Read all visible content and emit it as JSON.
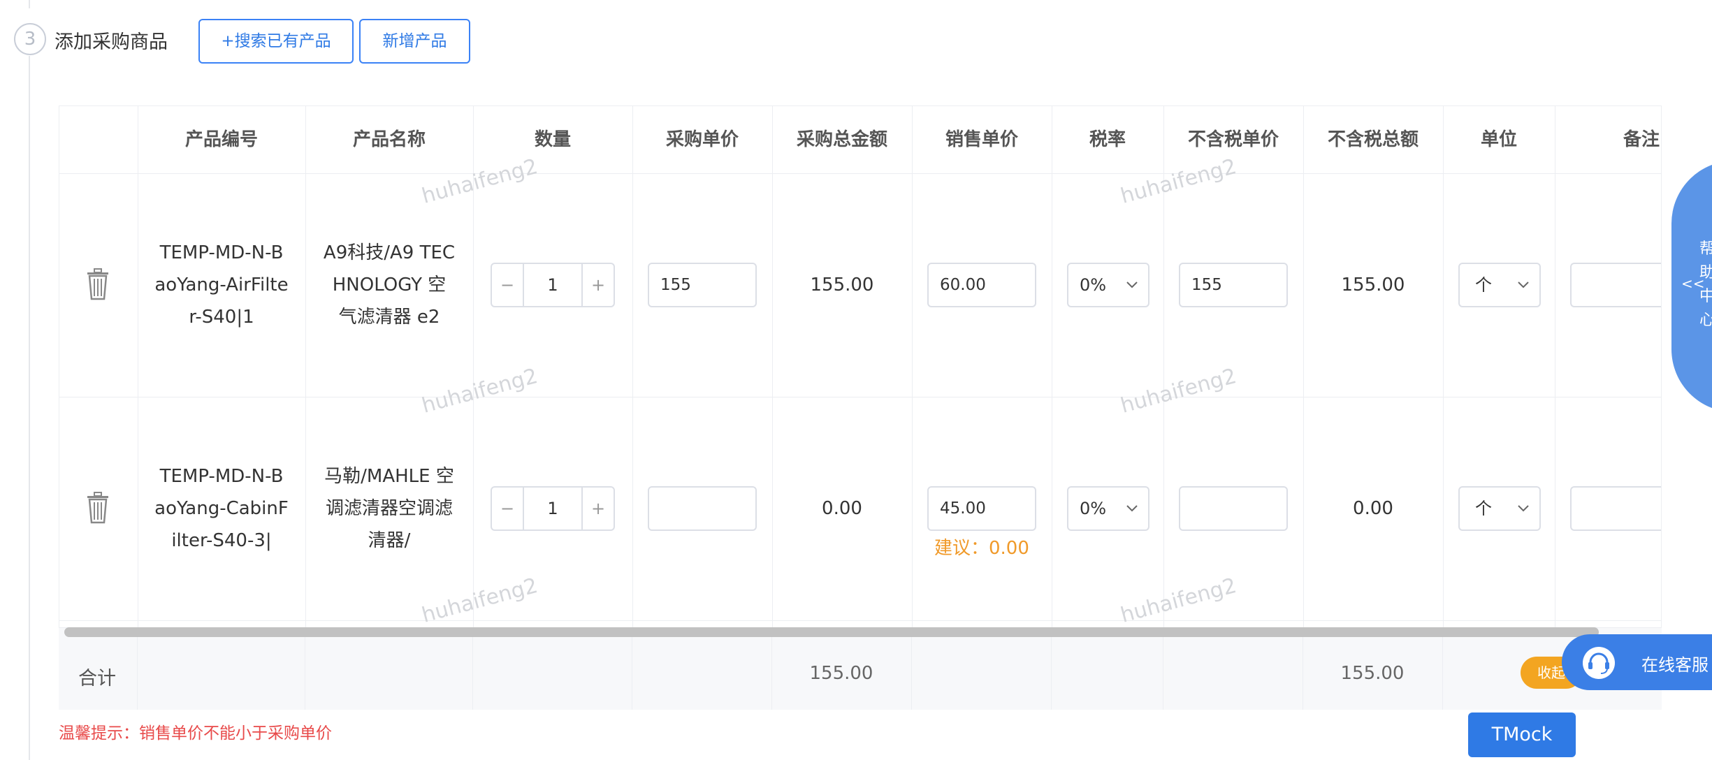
{
  "step": {
    "number": "3",
    "title": "添加采购商品"
  },
  "toolbar": {
    "search_label": "+搜索已有产品",
    "add_label": "新增产品"
  },
  "table": {
    "headers": [
      "产品编号",
      "产品名称",
      "数量",
      "采购单价",
      "采购总金额",
      "销售单价",
      "税率",
      "不含税单价",
      "不含税总额",
      "单位",
      "备注"
    ],
    "rows": [
      {
        "code_lines": [
          "TEMP-MD-N-B",
          "aoYang-AirFilte",
          "r-S40|1"
        ],
        "name_lines": [
          "A9科技/A9 TEC",
          "HNOLOGY 空",
          "气滤清器 e2"
        ],
        "qty": "1",
        "purchase_price": "155",
        "purchase_total": "155.00",
        "sale_price": "60.00",
        "suggest": "",
        "tax": "0%",
        "untaxed_price": "155",
        "untaxed_total": "155.00",
        "unit": "个",
        "remark": ""
      },
      {
        "code_lines": [
          "TEMP-MD-N-B",
          "aoYang-CabinF",
          "ilter-S40-3|"
        ],
        "name_lines": [
          "马勒/MAHLE 空",
          "调滤清器空调滤",
          "清器/"
        ],
        "qty": "1",
        "purchase_price": "",
        "purchase_total": "0.00",
        "sale_price": "45.00",
        "suggest": "建议：0.00",
        "tax": "0%",
        "untaxed_price": "",
        "untaxed_total": "0.00",
        "unit": "个",
        "remark": ""
      }
    ],
    "footer": {
      "label": "合计",
      "purchase_total": "155.00",
      "untaxed_total": "155.00"
    }
  },
  "tip": "温馨提示：销售单价不能小于采购单价",
  "watermark": "huhaifeng2",
  "help": {
    "label": "帮助中心",
    "arrow": "<<"
  },
  "service": {
    "collapse_label": "收起",
    "label": "在线客服"
  },
  "tmock": "TMock",
  "stepper": {
    "minus": "−",
    "plus": "+"
  },
  "colors": {
    "accent": "#2f7ae5",
    "warning": "#f09a2a",
    "danger": "#e84a4a",
    "help_bg": "#5b95e7"
  }
}
